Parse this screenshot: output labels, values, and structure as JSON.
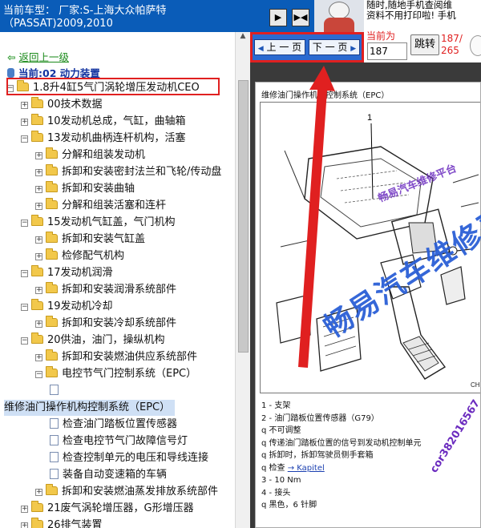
{
  "header": {
    "car_title": "当前车型： 厂家:S-上海大众帕萨特\n（PASSAT)2009,2010",
    "notice_lines": [
      "随时,随地手机查阅维",
      "资料不用打印啦! 手机"
    ],
    "nav_icons": [
      "window-forward-icon",
      "window-split-icon"
    ]
  },
  "tree": {
    "back_link": "返回上一级",
    "current": "当前:02 动力装置",
    "nodes": [
      {
        "label": "1.8升4缸5气门涡轮增压发动机CEO",
        "type": "folder",
        "expander": "−",
        "highlighted_box": true
      },
      {
        "label": "00技术数据",
        "type": "folder",
        "expander": "+"
      },
      {
        "label": "10发动机总成，气缸，曲轴箱",
        "type": "folder",
        "expander": "+"
      },
      {
        "label": "13发动机曲柄连杆机构，活塞",
        "type": "folder",
        "expander": "−"
      },
      {
        "label": "分解和组装发动机",
        "type": "folder",
        "expander": "+"
      },
      {
        "label": "拆卸和安装密封法兰和飞轮/传动盘",
        "type": "folder",
        "expander": "+"
      },
      {
        "label": "拆卸和安装曲轴",
        "type": "folder",
        "expander": "+"
      },
      {
        "label": "分解和组装活塞和连杆",
        "type": "folder",
        "expander": "+"
      },
      {
        "label": "15发动机气缸盖，气门机构",
        "type": "folder",
        "expander": "−"
      },
      {
        "label": "拆卸和安装气缸盖",
        "type": "folder",
        "expander": "+"
      },
      {
        "label": "检修配气机构",
        "type": "folder",
        "expander": "+"
      },
      {
        "label": "17发动机润滑",
        "type": "folder",
        "expander": "−"
      },
      {
        "label": "拆卸和安装润滑系统部件",
        "type": "folder",
        "expander": "+"
      },
      {
        "label": "19发动机冷却",
        "type": "folder",
        "expander": "−"
      },
      {
        "label": "拆卸和安装冷却系统部件",
        "type": "folder",
        "expander": "+"
      },
      {
        "label": "20供油，油门，操纵机构",
        "type": "folder",
        "expander": "−"
      },
      {
        "label": "拆卸和安装燃油供应系统部件",
        "type": "folder",
        "expander": "+"
      },
      {
        "label": "电控节气门控制系统（EPC）",
        "type": "folder",
        "expander": "−"
      },
      {
        "label": "",
        "type": "doc",
        "expander": ""
      },
      {
        "label": "维修油门操作机构控制系统（EPC）",
        "type": "selected",
        "expander": ""
      },
      {
        "label": "检查油门踏板位置传感器",
        "type": "doc",
        "expander": ""
      },
      {
        "label": "检查电控节气门故障信号灯",
        "type": "doc",
        "expander": ""
      },
      {
        "label": "检查控制单元的电压和导线连接",
        "type": "doc",
        "expander": ""
      },
      {
        "label": "装备自动变速箱的车辆",
        "type": "doc",
        "expander": ""
      },
      {
        "label": "拆卸和安装燃油蒸发排放系统部件",
        "type": "folder",
        "expander": "+"
      },
      {
        "label": "21废气涡轮增压器，G形增压器",
        "type": "folder",
        "expander": "+"
      },
      {
        "label": "26排气装置",
        "type": "folder",
        "expander": "+"
      }
    ]
  },
  "pager": {
    "prev_label": "上 一 页",
    "next_label": "下 一 页",
    "current_prefix": "当前为",
    "page_value": "187",
    "jump_label": "跳转",
    "page_count_line1": "187/",
    "page_count_line2": "265",
    "accent_color": "#e02020"
  },
  "document": {
    "title": "维修油门操作机构控制系统（EPC）",
    "callout_number": "1",
    "legend": [
      {
        "text": "1 - 支架"
      },
      {
        "text": "2 - 油门踏板位置传感器（G79）"
      },
      {
        "text": "q  不可调整"
      },
      {
        "text": "q  传递油门踏板位置的信号到发动机控制单元"
      },
      {
        "text": "q  拆卸时，拆卸驾驶员侧手套箱"
      },
      {
        "text": "q  检查 ",
        "link": "→ Kapitel"
      },
      {
        "text": "3 - 10 Nm"
      },
      {
        "text": "4 - 接头"
      },
      {
        "text": "q  黑色，6 针脚"
      }
    ]
  },
  "watermarks": {
    "small": "畅易汽车维修平台",
    "large": "畅易汽车维修平",
    "side": "cor382016567"
  }
}
